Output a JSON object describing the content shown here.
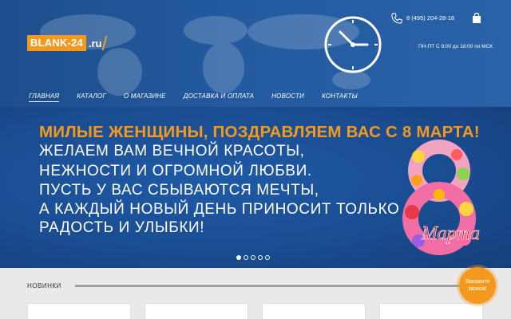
{
  "header": {
    "logo": {
      "box_text": "BLANK-24",
      "suffix": ".ru"
    },
    "phone": "8 (495) 204-28-18",
    "hours": "ПН-ПТ С 9:00 до 18:00 по МСК",
    "icons": {
      "phone": "phone-icon",
      "cart": "shopping-bag-icon",
      "clock": "clock-icon"
    },
    "colors": {
      "accent": "#f39a1e",
      "header_bg": "#1f5196"
    }
  },
  "nav": {
    "items": [
      "ГЛАВНАЯ",
      "КАТАЛОГ",
      "О МАГАЗИНЕ",
      "ДОСТАВКА И ОПЛАТА",
      "НОВОСТИ",
      "КОНТАКТЫ"
    ],
    "active_index": 0
  },
  "banner": {
    "title_part1": "МИЛЫЕ ЖЕНЩИНЫ",
    "title_part2": ", ПОЗДРАВЛЯЕМ ВАС С 8 МАРТА!",
    "lines": [
      "ЖЕЛАЕМ ВАМ ВЕЧНОЙ КРАСОТЫ,",
      "НЕЖНОСТИ И ОГРОМНОЙ ЛЮБВИ.",
      "ПУСТЬ У ВАС СБЫВАЮТСЯ МЕЧТЫ,",
      "А КАЖДЫЙ НОВЫЙ ДЕНЬ ПРИНОСИТ ТОЛЬКО",
      "РАДОСТЬ И УЛЫБКИ!"
    ],
    "image_caption": "Марта",
    "slides": {
      "count": 5,
      "active": 0
    }
  },
  "products": {
    "section_title": "НОВИНКИ",
    "cards_visible": 4
  },
  "callback": {
    "label": "Закажите звонок!"
  }
}
